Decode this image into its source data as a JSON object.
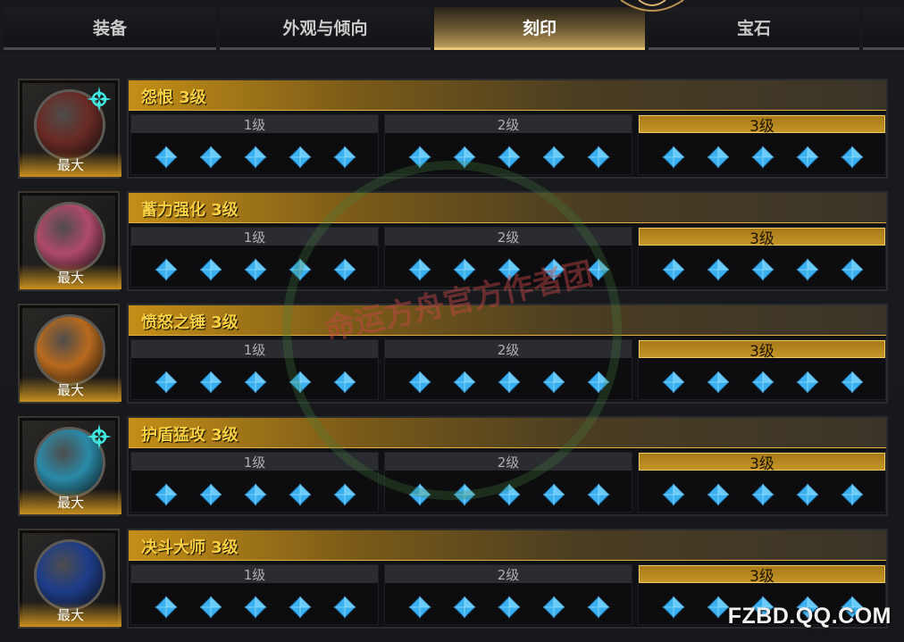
{
  "tabs": [
    {
      "label": "装备",
      "active": false
    },
    {
      "label": "外观与倾向",
      "active": false
    },
    {
      "label": "刻印",
      "active": true
    },
    {
      "label": "宝石",
      "active": false
    }
  ],
  "max_label": "最大",
  "tier_labels": [
    "1级",
    "2级",
    "3级"
  ],
  "active_tier_index": 2,
  "engravings": [
    {
      "name": "怨恨 3级",
      "icon": "resentment-engraving-icon",
      "orb_color": "#6a2a24",
      "has_rune": true
    },
    {
      "name": "蓄力强化 3级",
      "icon": "charge-enhancement-engraving-icon",
      "orb_color": "#b04a6a",
      "has_rune": false
    },
    {
      "name": "愤怒之锤 3级",
      "icon": "hammer-of-wrath-engraving-icon",
      "orb_color": "#b86a1e",
      "has_rune": false
    },
    {
      "name": "护盾猛攻 3级",
      "icon": "shield-assault-engraving-icon",
      "orb_color": "#2a8aa8",
      "has_rune": true
    },
    {
      "name": "决斗大师 3级",
      "icon": "duel-master-engraving-icon",
      "orb_color": "#1d3d8a",
      "has_rune": false
    }
  ],
  "gems_per_tier": 5,
  "gem_color": "#3ab0f0",
  "accent_color": "#f7d043",
  "watermark_text": "命运方舟官方作者团",
  "footer_logo": "FZBD.QQ.COM"
}
